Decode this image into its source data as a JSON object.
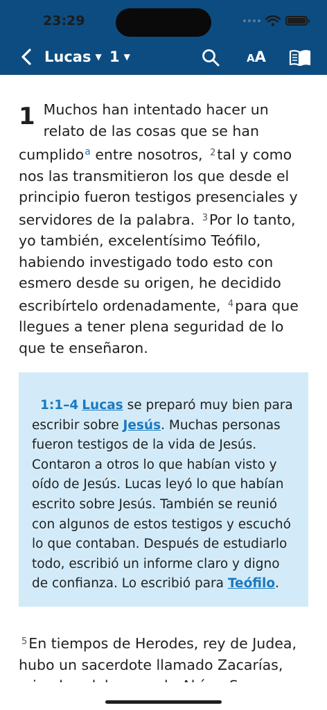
{
  "status": {
    "time": "23:29"
  },
  "nav": {
    "book": "Lucas",
    "chapter": "1",
    "textsize_small": "A",
    "textsize_big": "A"
  },
  "passage": {
    "chapter_number": "1",
    "v1_a": "Muchos han intentado hacer un relato de las cosas que se han cumplido",
    "v1_footnote": "a",
    "v1_b": " entre nosotros,",
    "v2_num": "2",
    "v2": "tal y como nos las transmitieron los que desde el principio fueron testigos presenciales y servidores de la palabra.",
    "v3_num": "3",
    "v3": "Por lo tanto, yo también, excelentísimo Teófilo, habiendo investigado todo esto con esmero desde su origen, he decidido escribírtelo ordenadamente,",
    "v4_num": "4",
    "v4": "para que llegues a tener plena seguridad de lo que te enseñaron."
  },
  "note": {
    "ref": "1:1–4",
    "link_lucas": "Lucas",
    "t1": " se preparó muy bien para escribir sobre ",
    "link_jesus": "Jesús",
    "t2": ". Muchas personas fueron testigos de la vida de Jesús. Contaron a otros lo que habían visto y oído de Jesús. Lucas leyó lo que habían escrito sobre Jesús. También se reunió con algunos de estos testigos y escuchó lo que contaban. Después de estudiarlo todo, escribió un informe claro y digno de confianza. Lo escribió para ",
    "link_teofilo": "Teófilo",
    "t3": "."
  },
  "passage2": {
    "v5_num": "5",
    "v5": "En tiempos de Herodes, rey de Judea, hubo un sacerdote llamado Zacarías, miembro del grupo de Abías. Su esposa"
  }
}
